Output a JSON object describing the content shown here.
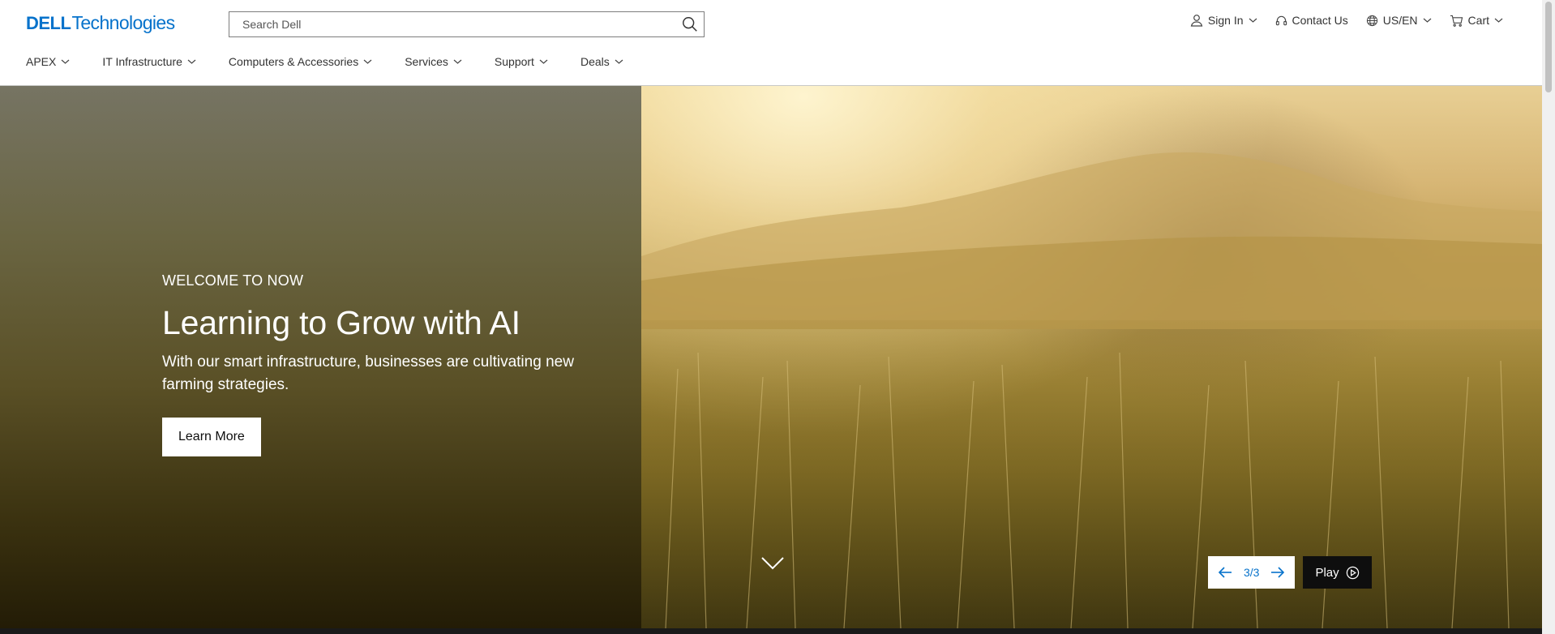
{
  "header": {
    "logo": {
      "dell": "DELL",
      "technologies": "Technologies"
    },
    "search": {
      "placeholder": "Search Dell"
    },
    "utility": [
      {
        "label": "Sign In",
        "icon": "user-icon"
      },
      {
        "label": "Contact Us",
        "icon": "headset-icon"
      },
      {
        "label": "US/EN",
        "icon": "globe-icon"
      },
      {
        "label": "Cart",
        "icon": "cart-icon"
      }
    ]
  },
  "nav": {
    "items": [
      {
        "label": "APEX"
      },
      {
        "label": "IT Infrastructure"
      },
      {
        "label": "Computers & Accessories"
      },
      {
        "label": "Services"
      },
      {
        "label": "Support"
      },
      {
        "label": "Deals"
      }
    ]
  },
  "hero": {
    "eyebrow": "WELCOME TO NOW",
    "headline": "Learning to Grow with AI",
    "subhead": "With our smart infrastructure, businesses are cultivating new farming strategies.",
    "cta_label": "Learn More",
    "carousel": {
      "counter": "3/3",
      "play_label": "Play"
    }
  },
  "colors": {
    "brand_blue": "#0672cb",
    "dark": "#0e0e0e"
  }
}
